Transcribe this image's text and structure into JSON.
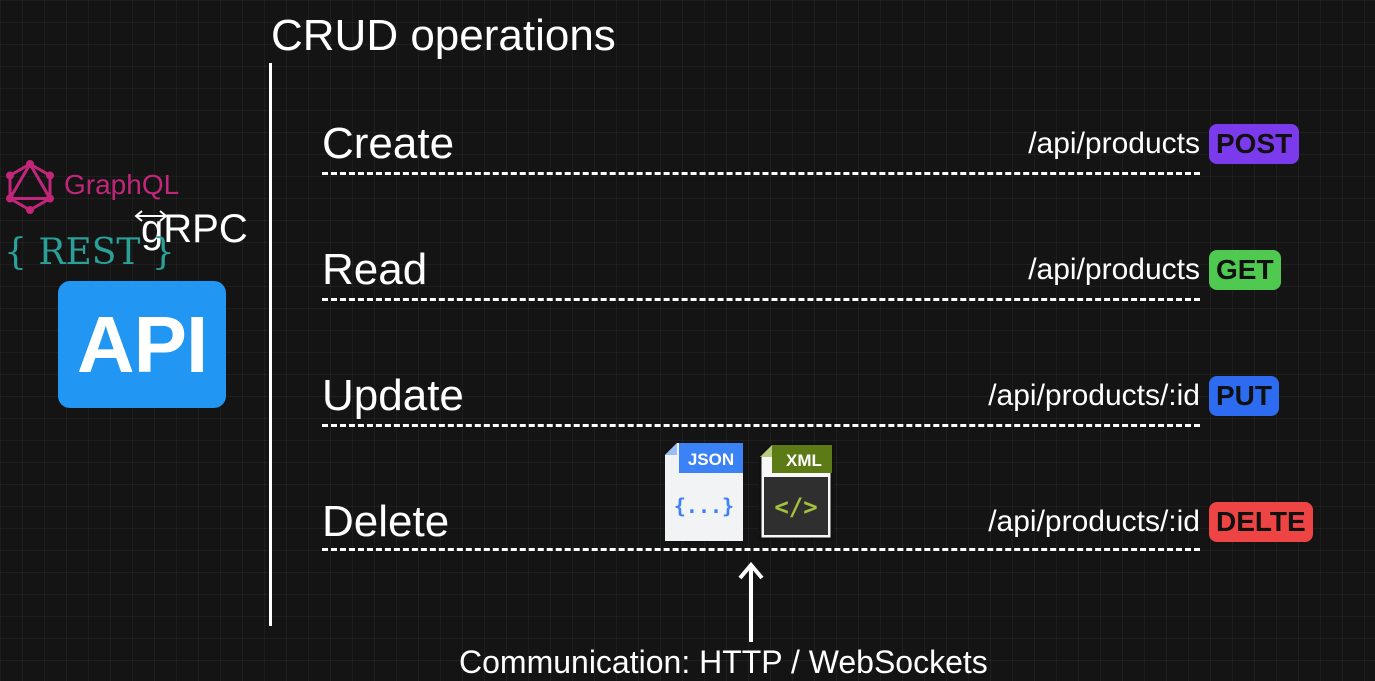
{
  "title": "CRUD operations",
  "logos": {
    "graphql": "GraphQL",
    "grpc": "gRPC",
    "rest": "{ REST }",
    "api": "API"
  },
  "operations": [
    {
      "label": "Create",
      "endpoint": "/api/products",
      "method": "POST",
      "color": "#7c3aed"
    },
    {
      "label": "Read",
      "endpoint": "/api/products",
      "method": "GET",
      "color": "#4fc94f"
    },
    {
      "label": "Update",
      "endpoint": "/api/products/:id",
      "method": "PUT",
      "color": "#2d6bf0"
    },
    {
      "label": "Delete",
      "endpoint": "/api/products/:id",
      "method": "DELTE",
      "color": "#ef4444"
    }
  ],
  "formats": {
    "json_label": "JSON",
    "json_body": "{...}",
    "xml_label": "XML",
    "xml_body": "</>"
  },
  "communication": "Communication: HTTP / WebSockets"
}
